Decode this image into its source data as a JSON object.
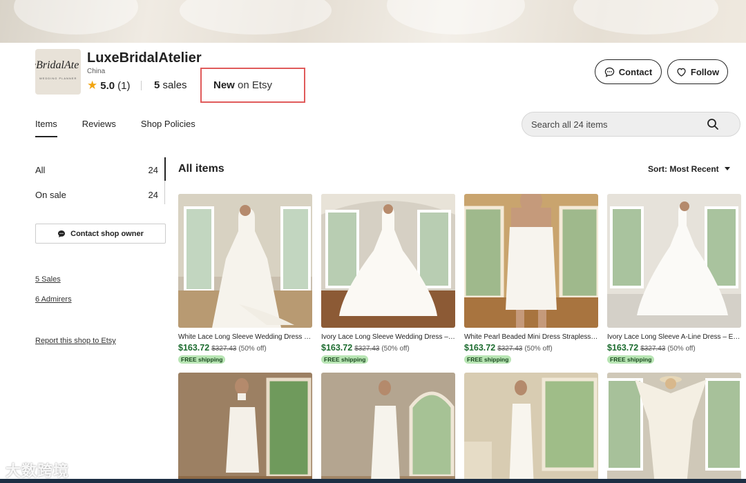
{
  "shop": {
    "name": "LuxeBridalAtelier",
    "logo_text": "eBridalAte",
    "logo_sub": "WEDDING PLANNER",
    "location": "China",
    "rating": "5.0",
    "review_count": "(1)",
    "sales_count": "5",
    "sales_label": "sales",
    "new_strong": "New",
    "new_rest": "on Etsy"
  },
  "buttons": {
    "contact": "Contact",
    "follow": "Follow",
    "contact_owner": "Contact shop owner"
  },
  "tabs": [
    {
      "label": "Items",
      "active": true
    },
    {
      "label": "Reviews"
    },
    {
      "label": "Shop Policies"
    }
  ],
  "search": {
    "placeholder": "Search all 24 items"
  },
  "sidebar": {
    "sections": [
      {
        "label": "All",
        "count": "24"
      },
      {
        "label": "On sale",
        "count": "24"
      }
    ],
    "links": {
      "sales": "5 Sales",
      "admirers": "6 Admirers",
      "report": "Report this shop to Etsy"
    }
  },
  "main": {
    "title": "All items",
    "sort_label": "Sort: Most Recent"
  },
  "listings": [
    {
      "title": "White Lace Long Sleeve Wedding Dress – Elegant...",
      "price": "$163.72",
      "orig": "$327.43",
      "discount": "(50% off)",
      "shipping": "FREE shipping"
    },
    {
      "title": "Ivory Lace Long Sleeve Wedding Dress – Romantic...",
      "price": "$163.72",
      "orig": "$327.43",
      "discount": "(50% off)",
      "shipping": "FREE shipping"
    },
    {
      "title": "White Pearl Beaded Mini Dress Strapless Bridal...",
      "price": "$163.72",
      "orig": "$327.43",
      "discount": "(50% off)",
      "shipping": "FREE shipping"
    },
    {
      "title": "Ivory Lace Long Sleeve A-Line Dress – Elegant...",
      "price": "$163.72",
      "orig": "$327.43",
      "discount": "(50% off)",
      "shipping": "FREE shipping"
    },
    {
      "title": "",
      "price": "",
      "orig": "",
      "discount": "",
      "shipping": ""
    },
    {
      "title": "",
      "price": "",
      "orig": "",
      "discount": "",
      "shipping": ""
    },
    {
      "title": "",
      "price": "",
      "orig": "",
      "discount": "",
      "shipping": ""
    },
    {
      "title": "",
      "price": "",
      "orig": "",
      "discount": "",
      "shipping": ""
    }
  ],
  "watermark": "大数跨境",
  "colors": {
    "accent_red": "#e05a5a",
    "price_green": "#1b6b2e",
    "ship_badge": "#b8e5b4",
    "star": "#f1a410"
  }
}
